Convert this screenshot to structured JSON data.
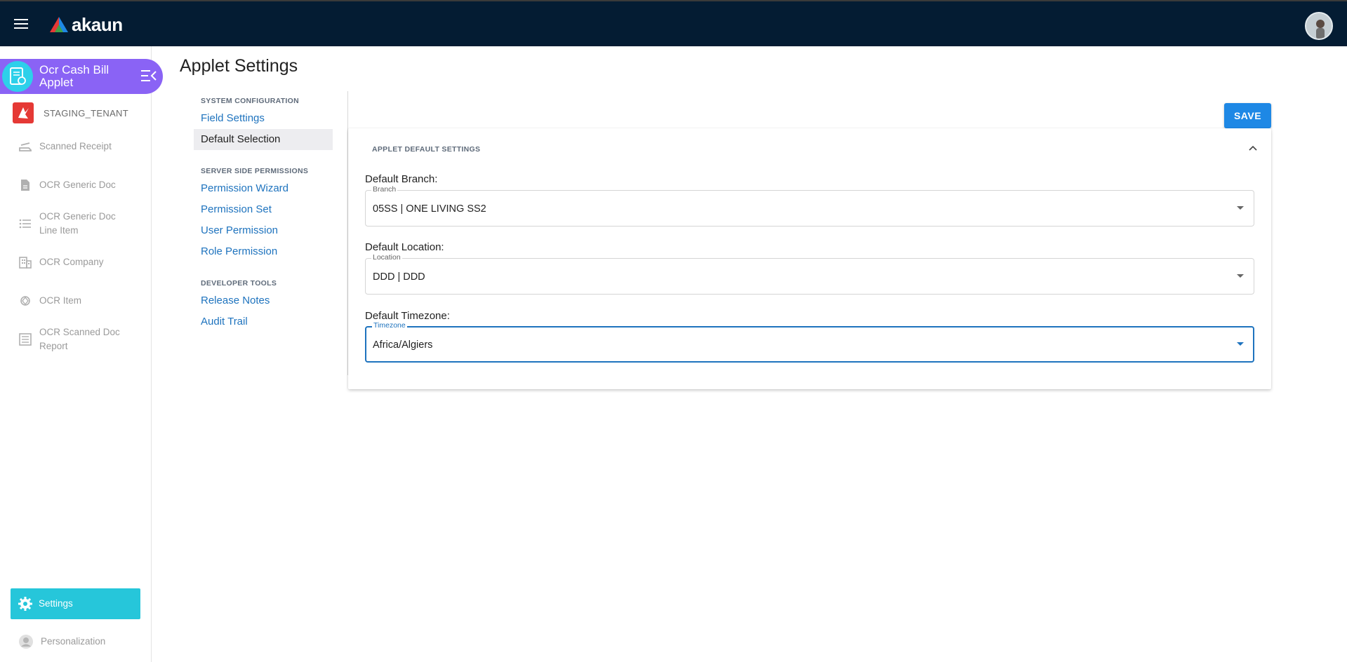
{
  "topbar": {
    "brand": "akaun"
  },
  "sidebar": {
    "applet_title": "Ocr Cash Bill Applet",
    "tenant": "STAGING_TENANT",
    "items": [
      {
        "label": "Scanned Receipt",
        "icon": "scanner-icon"
      },
      {
        "label": "OCR Generic Doc",
        "icon": "document-icon"
      },
      {
        "label": "OCR Generic Doc Line Item",
        "icon": "list-icon"
      },
      {
        "label": "OCR Company",
        "icon": "building-icon"
      },
      {
        "label": "OCR Item",
        "icon": "item-icon"
      },
      {
        "label": "OCR Scanned Doc Report",
        "icon": "report-icon"
      }
    ],
    "settings_label": "Settings",
    "personalization_label": "Personalization"
  },
  "page": {
    "title": "Applet Settings"
  },
  "settings_nav": {
    "system_configuration": "SYSTEM CONFIGURATION",
    "field_settings": "Field Settings",
    "default_selection": "Default Selection",
    "server_side_permissions": "SERVER SIDE PERMISSIONS",
    "permission_wizard": "Permission Wizard",
    "permission_set": "Permission Set",
    "user_permission": "User Permission",
    "role_permission": "Role Permission",
    "developer_tools": "DEVELOPER TOOLS",
    "release_notes": "Release Notes",
    "audit_trail": "Audit Trail"
  },
  "toolbar": {
    "save_label": "SAVE"
  },
  "panel": {
    "heading": "APPLET DEFAULT SETTINGS",
    "branch": {
      "label": "Default Branch:",
      "legend": "Branch",
      "value": "05SS | ONE LIVING SS2"
    },
    "location": {
      "label": "Default Location:",
      "legend": "Location",
      "value": "DDD | DDD"
    },
    "timezone": {
      "label": "Default Timezone:",
      "legend": "Timezone",
      "value": "Africa/Algiers"
    }
  },
  "colors": {
    "topbar": "#041c33",
    "applet_header": "#8a63f5",
    "settings_active": "#26c6da",
    "accent": "#1e88e5",
    "link": "#1e73be"
  }
}
